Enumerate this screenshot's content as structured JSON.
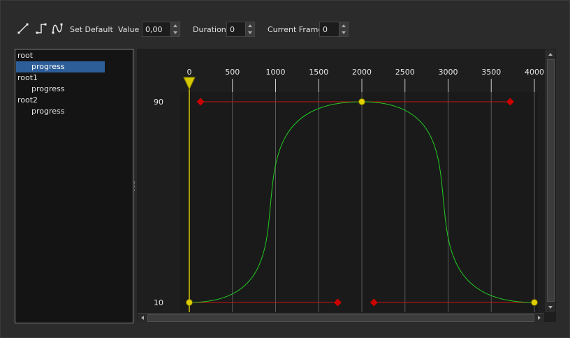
{
  "toolbar": {
    "tools": [
      {
        "name": "linear-interpolation-icon"
      },
      {
        "name": "step-interpolation-icon"
      },
      {
        "name": "bezier-interpolation-icon"
      }
    ],
    "set_default_label": "Set Default",
    "value_label": "Value",
    "value": "0,00",
    "duration_label": "Duration",
    "duration": "0",
    "current_frame_label": "Current Frame",
    "current_frame": "0"
  },
  "tree": {
    "items": [
      {
        "label": "root",
        "level": 0,
        "selected": false
      },
      {
        "label": "progress",
        "level": 1,
        "selected": true
      },
      {
        "label": "root1",
        "level": 0,
        "selected": false
      },
      {
        "label": "progress",
        "level": 1,
        "selected": false
      },
      {
        "label": "root2",
        "level": 0,
        "selected": false
      },
      {
        "label": "progress",
        "level": 1,
        "selected": false
      }
    ]
  },
  "colors": {
    "curve": "#22cc22",
    "handle_line": "#cc1111",
    "handle": "#cc0000",
    "keyframe": "#e0d000",
    "playhead": "#d4c800",
    "selection": "#2e5e98"
  },
  "chart_data": {
    "type": "line",
    "x_ticks": [
      "0",
      "500",
      "1000",
      "1500",
      "2000",
      "2500",
      "3000",
      "3500",
      "4000"
    ],
    "x_values": [
      0,
      500,
      1000,
      1500,
      2000,
      2500,
      3000,
      3500,
      4000
    ],
    "y_ticks": [
      "10",
      "90"
    ],
    "y_values": [
      10,
      90
    ],
    "xlim": [
      0,
      4000
    ],
    "ylim": [
      10,
      90
    ],
    "grid": true,
    "keyframes": [
      {
        "x": 0,
        "y": 10
      },
      {
        "x": 2000,
        "y": 90
      },
      {
        "x": 4000,
        "y": 10
      }
    ],
    "handles": [
      {
        "x": 130,
        "y": 90
      },
      {
        "x": 1720,
        "y": 10
      },
      {
        "x": 2140,
        "y": 10
      },
      {
        "x": 3720,
        "y": 90
      }
    ],
    "playhead_x": 0
  }
}
